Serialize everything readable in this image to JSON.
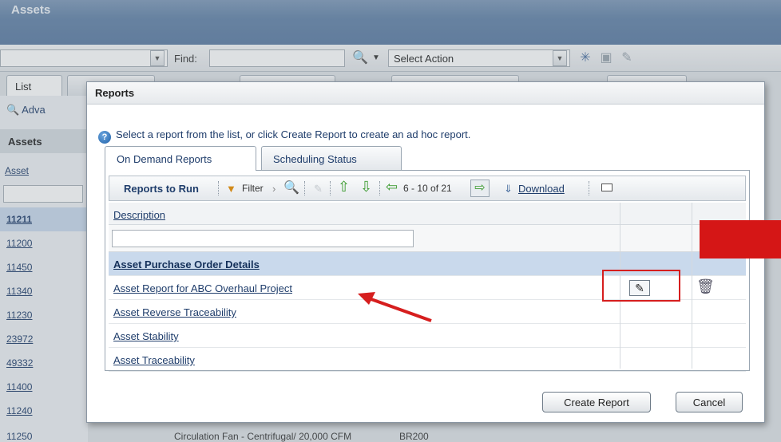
{
  "app": {
    "title": "Assets"
  },
  "toolbar": {
    "find_label": "Find:",
    "find_value": "",
    "action_value": "Select Action"
  },
  "background": {
    "tab_list": "List",
    "advanced_label": "Adva",
    "assets_header": "Assets",
    "asset_col": "Asset",
    "asset_rows": [
      "11211",
      "11200",
      "11450",
      "11340",
      "11230",
      "23972",
      "49332",
      "11400",
      "11240",
      "11250"
    ],
    "last_row_description": "Circulation Fan - Centrifugal/ 20,000 CFM",
    "last_row_code": "BR200"
  },
  "dialog": {
    "title": "Reports",
    "hint": "Select a report from the list, or click Create Report to create an ad hoc report.",
    "tabs": [
      "On Demand Reports",
      "Scheduling Status"
    ],
    "grid_title": "Reports to Run",
    "filter_label": "Filter",
    "pagination": "6 - 10 of 21",
    "download_label": "Download",
    "column_description": "Description",
    "filter_value": "",
    "rows": [
      "Asset Purchase Order Details",
      "Asset Report for ABC Overhaul Project",
      "Asset Reverse Traceability",
      "Asset Stability",
      "Asset Traceability"
    ],
    "create_button": "Create Report",
    "cancel_button": "Cancel"
  },
  "colors": {
    "accent": "#1f3d6b",
    "annotation": "#d61e1e",
    "selected_row": "#c9d9ec"
  }
}
